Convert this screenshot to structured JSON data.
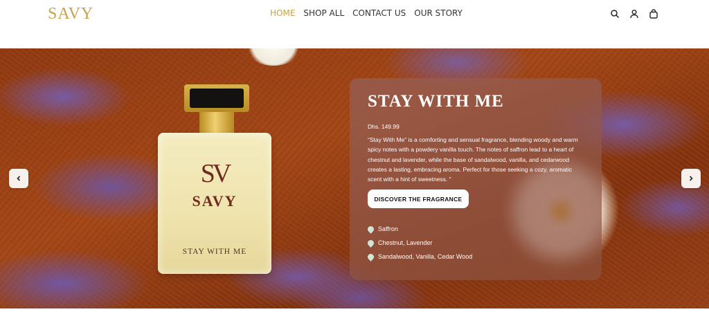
{
  "header": {
    "logo": "SAVY",
    "nav": [
      {
        "label": "HOME",
        "active": true
      },
      {
        "label": "SHOP ALL",
        "active": false
      },
      {
        "label": "CONTACT US",
        "active": false
      },
      {
        "label": "OUR STORY",
        "active": false
      }
    ],
    "icons": [
      "search-icon",
      "account-icon",
      "bag-icon"
    ]
  },
  "hero": {
    "bottle": {
      "monogram": "SV",
      "brand": "SAVY",
      "name": "STAY WITH ME"
    },
    "product": {
      "title": "STAY WITH ME",
      "price": "Dhs. 149.99",
      "description": "“Stay With Me” is a comforting and sensual fragrance, blending woody and warm spicy notes with a powdery vanilla touch. The notes of saffron lead to a heart of chestnut and lavender, while the base of sandalwood, vanilla, and cedarwood creates a lasting, embracing aroma. Perfect for those seeking a cozy, aromatic scent with a hint of sweetness. \"",
      "cta": "DISCOVER THE FRAGRANCE",
      "notes": [
        "Saffron",
        "Chestnut, Lavender",
        "Sandalwood, Vanilla, Cedar Wood"
      ]
    },
    "arrows": [
      "chevron-left-icon",
      "chevron-right-icon"
    ]
  },
  "colors": {
    "accent": "#c9a24a",
    "nav_text": "#333333",
    "note_icon": "#cfe6d7"
  }
}
